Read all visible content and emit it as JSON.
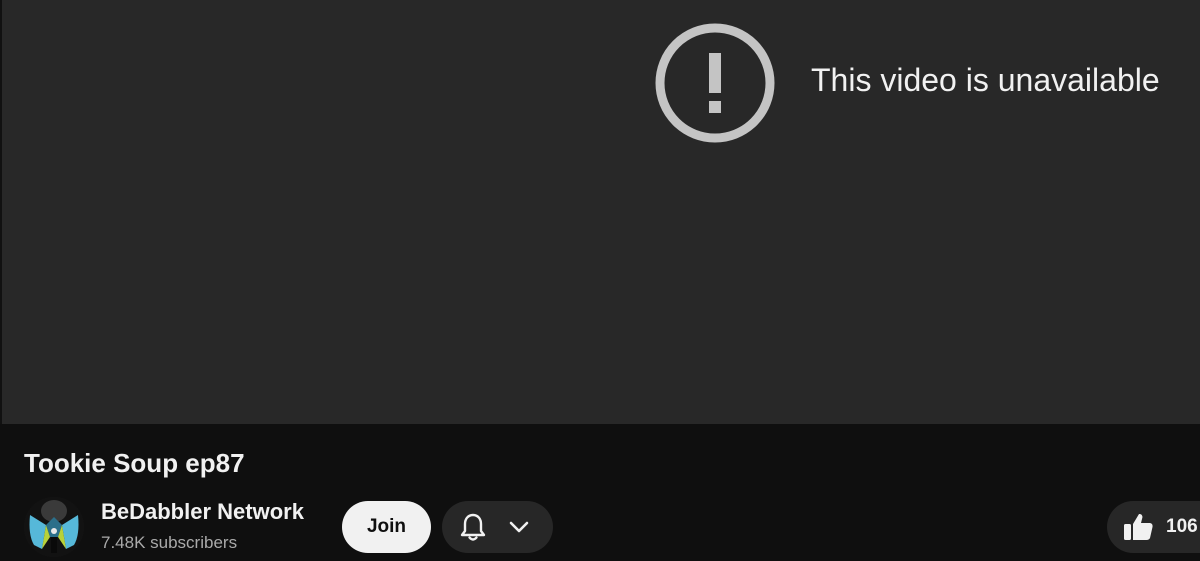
{
  "player": {
    "error_message": "This video is unavailable",
    "error_icon": "exclamation-circle-icon",
    "icon_color": "#c4c4c4"
  },
  "video": {
    "title": "Tookie Soup ep87"
  },
  "channel": {
    "name": "BeDabbler Network",
    "subscribers": "7.48K subscribers",
    "avatar_icon": "channel-logo-avatar"
  },
  "actions": {
    "join_label": "Join",
    "notify_icon": "bell-icon",
    "notify_menu_icon": "chevron-down-icon",
    "like_icon": "thumbs-up-icon",
    "like_count": "106"
  },
  "colors": {
    "player_bg": "#282828",
    "page_bg": "#0f0f0f",
    "button_dark": "#272727",
    "button_light": "#f1f1f1",
    "secondary_text": "#aaaaaa"
  }
}
